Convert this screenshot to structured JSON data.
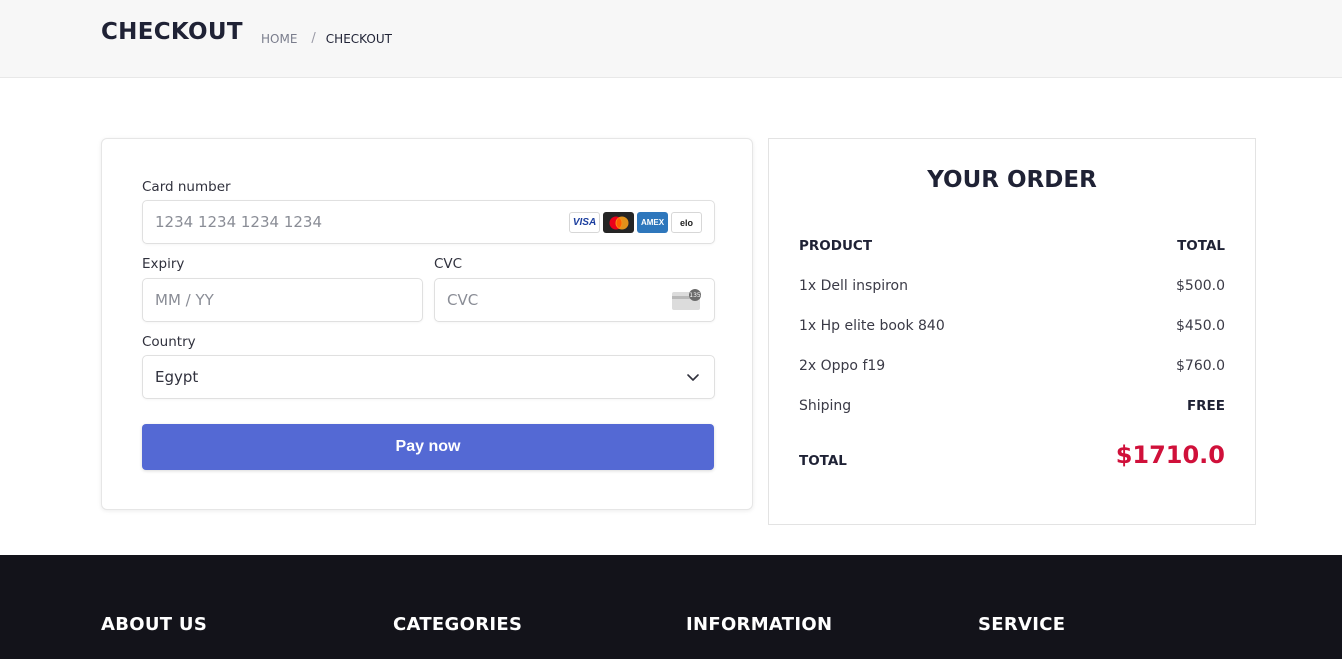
{
  "header": {
    "title": "CHECKOUT",
    "breadcrumb": {
      "home": "HOME",
      "separator": "/",
      "current": "CHECKOUT"
    }
  },
  "payment_form": {
    "card_number": {
      "label": "Card number",
      "placeholder": "1234 1234 1234 1234",
      "brands": [
        "VISA",
        "mastercard",
        "AMEX",
        "elo"
      ]
    },
    "expiry": {
      "label": "Expiry",
      "placeholder": "MM / YY"
    },
    "cvc": {
      "label": "CVC",
      "placeholder": "CVC",
      "icon_text": "135"
    },
    "country": {
      "label": "Country",
      "value": "Egypt"
    },
    "pay_button_label": "Pay now",
    "accent_color": "#5469d4"
  },
  "order": {
    "title": "YOUR ORDER",
    "columns": {
      "product": "PRODUCT",
      "total": "TOTAL"
    },
    "items": [
      {
        "name": "1x Dell inspiron",
        "price": "$500.0"
      },
      {
        "name": "1x Hp elite book 840",
        "price": "$450.0"
      },
      {
        "name": "2x Oppo f19",
        "price": "$760.0"
      }
    ],
    "shipping": {
      "label": "Shiping",
      "value": "FREE"
    },
    "total": {
      "label": "TOTAL",
      "value": "$1710.0"
    },
    "total_color": "#d0103a"
  },
  "footer": {
    "headings": [
      "ABOUT US",
      "CATEGORIES",
      "INFORMATION",
      "SERVICE"
    ]
  }
}
